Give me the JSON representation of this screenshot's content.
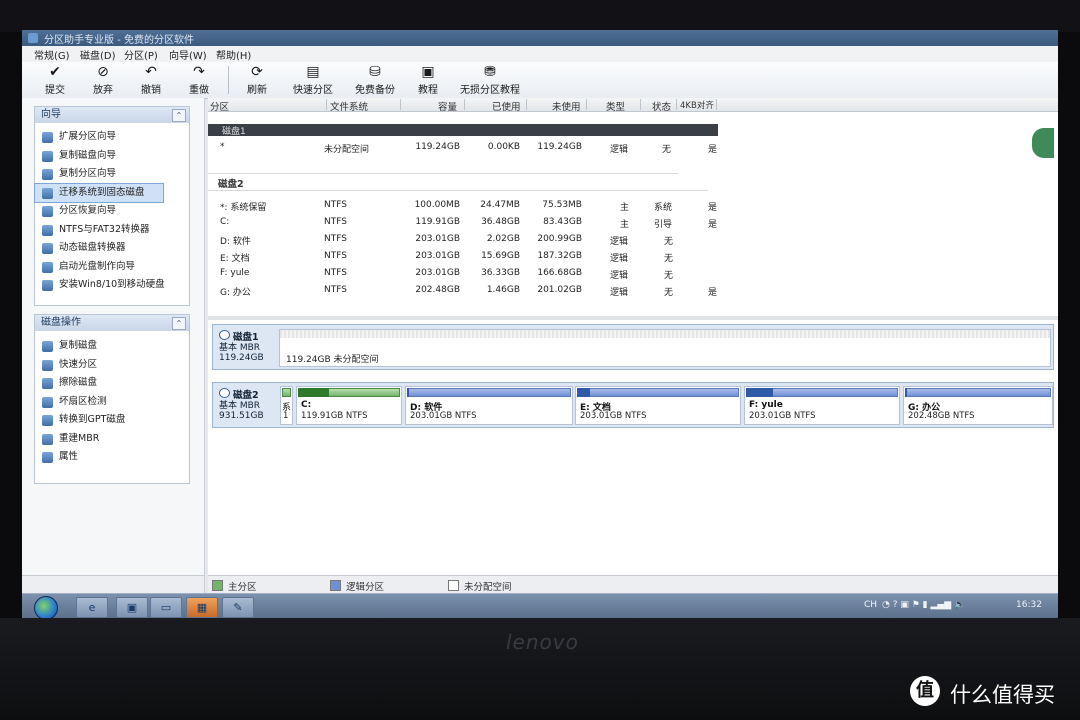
{
  "app": {
    "title": "分区助手专业版 - 免费的分区软件"
  },
  "menu": [
    "常规(G)",
    "磁盘(D)",
    "分区(P)",
    "向导(W)",
    "帮助(H)"
  ],
  "toolbar": [
    {
      "label": "提交",
      "icon": "check-icon"
    },
    {
      "label": "放弃",
      "icon": "discard-icon"
    },
    {
      "label": "撤销",
      "icon": "undo-icon"
    },
    {
      "label": "重做",
      "icon": "redo-icon"
    },
    {
      "label": "刷新",
      "icon": "refresh-icon"
    },
    {
      "label": "快速分区",
      "icon": "quick-partition-icon"
    },
    {
      "label": "免费备份",
      "icon": "backup-icon"
    },
    {
      "label": "教程",
      "icon": "tutorial-icon"
    },
    {
      "label": "无损分区教程",
      "icon": "lossless-tutorial-icon"
    }
  ],
  "wizard_panel": {
    "title": "向导",
    "items": [
      "扩展分区向导",
      "复制磁盘向导",
      "复制分区向导",
      "迁移系统到固态磁盘",
      "分区恢复向导",
      "NTFS与FAT32转换器",
      "动态磁盘转换器",
      "启动光盘制作向导",
      "安装Win8/10到移动硬盘"
    ],
    "selected": "迁移系统到固态磁盘"
  },
  "disk_ops_panel": {
    "title": "磁盘操作",
    "items": [
      "复制磁盘",
      "快速分区",
      "擦除磁盘",
      "坏扇区检测",
      "转换到GPT磁盘",
      "重建MBR",
      "属性"
    ]
  },
  "columns": [
    "分区",
    "文件系统",
    "容量",
    "已使用",
    "未使用",
    "类型",
    "状态",
    "4KB对齐"
  ],
  "disk1_label": "磁盘1",
  "disk1_rows": [
    {
      "partition": "*",
      "fs": "未分配空间",
      "capacity": "119.24GB",
      "used": "0.00KB",
      "unused": "119.24GB",
      "type": "逻辑",
      "status": "无",
      "align": "是"
    }
  ],
  "disk2_label": "磁盘2",
  "disk2_rows": [
    {
      "partition": "*: 系统保留",
      "fs": "NTFS",
      "capacity": "100.00MB",
      "used": "24.47MB",
      "unused": "75.53MB",
      "type": "主",
      "status": "系统",
      "align": "是"
    },
    {
      "partition": "C:",
      "fs": "NTFS",
      "capacity": "119.91GB",
      "used": "36.48GB",
      "unused": "83.43GB",
      "type": "主",
      "status": "引导",
      "align": "是"
    },
    {
      "partition": "D: 软件",
      "fs": "NTFS",
      "capacity": "203.01GB",
      "used": "2.02GB",
      "unused": "200.99GB",
      "type": "逻辑",
      "status": "无",
      "align": ""
    },
    {
      "partition": "E: 文档",
      "fs": "NTFS",
      "capacity": "203.01GB",
      "used": "15.69GB",
      "unused": "187.32GB",
      "type": "逻辑",
      "status": "无",
      "align": ""
    },
    {
      "partition": "F: yule",
      "fs": "NTFS",
      "capacity": "203.01GB",
      "used": "36.33GB",
      "unused": "166.68GB",
      "type": "逻辑",
      "status": "无",
      "align": ""
    },
    {
      "partition": "G: 办公",
      "fs": "NTFS",
      "capacity": "202.48GB",
      "used": "1.46GB",
      "unused": "201.02GB",
      "type": "逻辑",
      "status": "无",
      "align": "是"
    }
  ],
  "disk_map": {
    "disk1": {
      "name": "磁盘1",
      "kind": "基本 MBR",
      "size": "119.24GB",
      "unalloc_text": "119.24GB 未分配空间"
    },
    "disk2": {
      "name": "磁盘2",
      "kind": "基本 MBR",
      "size": "931.51GB",
      "reserved": {
        "name": "系",
        "size": "1"
      },
      "parts": [
        {
          "name": "C:",
          "size": "119.91GB NTFS",
          "used_fraction": 0.3,
          "kind": "primary"
        },
        {
          "name": "D: 软件",
          "size": "203.01GB NTFS",
          "used_fraction": 0.01,
          "kind": "logical"
        },
        {
          "name": "E: 文档",
          "size": "203.01GB NTFS",
          "used_fraction": 0.08,
          "kind": "logical"
        },
        {
          "name": "F: yule",
          "size": "203.01GB NTFS",
          "used_fraction": 0.18,
          "kind": "logical"
        },
        {
          "name": "G: 办公",
          "size": "202.48GB NTFS",
          "used_fraction": 0.01,
          "kind": "logical"
        }
      ]
    }
  },
  "legend": {
    "primary": "主分区",
    "logical": "逻辑分区",
    "unallocated": "未分配空间"
  },
  "colors": {
    "primary": "#74b46a",
    "logical": "#6f8fd6",
    "unallocated": "#ffffff"
  },
  "tray": {
    "lang": "CH",
    "time": "16:32"
  },
  "bezel": {
    "brand": "lenovo"
  },
  "watermark": {
    "logo": "值",
    "text": "什么值得买"
  }
}
